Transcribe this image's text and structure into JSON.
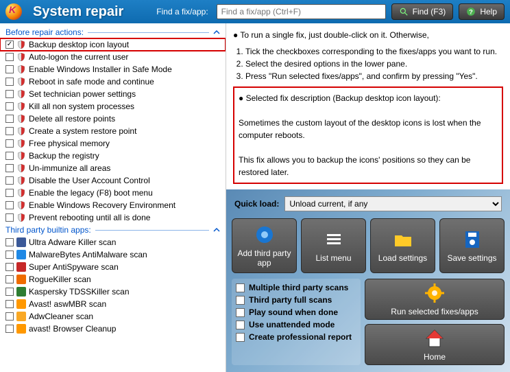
{
  "header": {
    "title": "System repair",
    "find_label": "Find a fix/app:",
    "search_placeholder": "Find a fix/app (Ctrl+F)",
    "find_btn": "Find (F3)",
    "help_btn": "Help"
  },
  "sections": {
    "before": "Before repair actions:",
    "third": "Third party builtin apps:"
  },
  "before_items": [
    {
      "label": "Backup desktop icon layout",
      "checked": true,
      "selected": true
    },
    {
      "label": "Auto-logon the current user"
    },
    {
      "label": "Enable Windows Installer in Safe Mode"
    },
    {
      "label": "Reboot in safe mode and continue"
    },
    {
      "label": "Set technician power settings"
    },
    {
      "label": "Kill all non system processes"
    },
    {
      "label": "Delete all restore points"
    },
    {
      "label": "Create a system restore point"
    },
    {
      "label": "Free physical memory"
    },
    {
      "label": "Backup the registry"
    },
    {
      "label": "Un-immunize all areas"
    },
    {
      "label": "Disable the User Account Control"
    },
    {
      "label": "Enable the legacy (F8) boot menu"
    },
    {
      "label": "Enable Windows Recovery Environment"
    },
    {
      "label": "Prevent rebooting until all is done"
    }
  ],
  "third_items": [
    {
      "label": "Ultra Adware Killer scan",
      "color": "#3b5998"
    },
    {
      "label": "MalwareBytes AntiMalware scan",
      "color": "#1e88e5"
    },
    {
      "label": "Super AntiSpyware scan",
      "color": "#c62828"
    },
    {
      "label": "RogueKiller scan",
      "color": "#ef6c00"
    },
    {
      "label": "Kaspersky TDSSKiller scan",
      "color": "#2e7d32"
    },
    {
      "label": "Avast! aswMBR scan",
      "color": "#ff9800"
    },
    {
      "label": "AdwCleaner scan",
      "color": "#f9a825"
    },
    {
      "label": "avast! Browser Cleanup",
      "color": "#ff9800"
    }
  ],
  "desc": {
    "line1": "To run a single fix, just double-click on it. Otherwise,",
    "steps": [
      "Tick the checkboxes corresponding to the fixes/apps you want to run.",
      "Select the desired options in the lower pane.",
      "Press \"Run selected fixes/apps\", and confirm by pressing \"Yes\"."
    ],
    "sel_title": "Selected fix description (Backup desktop icon layout):",
    "sel_p1": "Sometimes the custom layout of the desktop icons is lost when the computer reboots.",
    "sel_p2": "This fix allows you to backup the icons' positions so they can be restored later."
  },
  "panel": {
    "quick_label": "Quick load:",
    "quick_value": "Unload current, if any",
    "big": [
      "Add third party app",
      "List menu",
      "Load settings",
      "Save settings"
    ],
    "opts": [
      "Multiple third party scans",
      "Third party full scans",
      "Play sound when done",
      "Use unattended mode",
      "Create professional report"
    ],
    "run": "Run selected fixes/apps",
    "home": "Home"
  }
}
